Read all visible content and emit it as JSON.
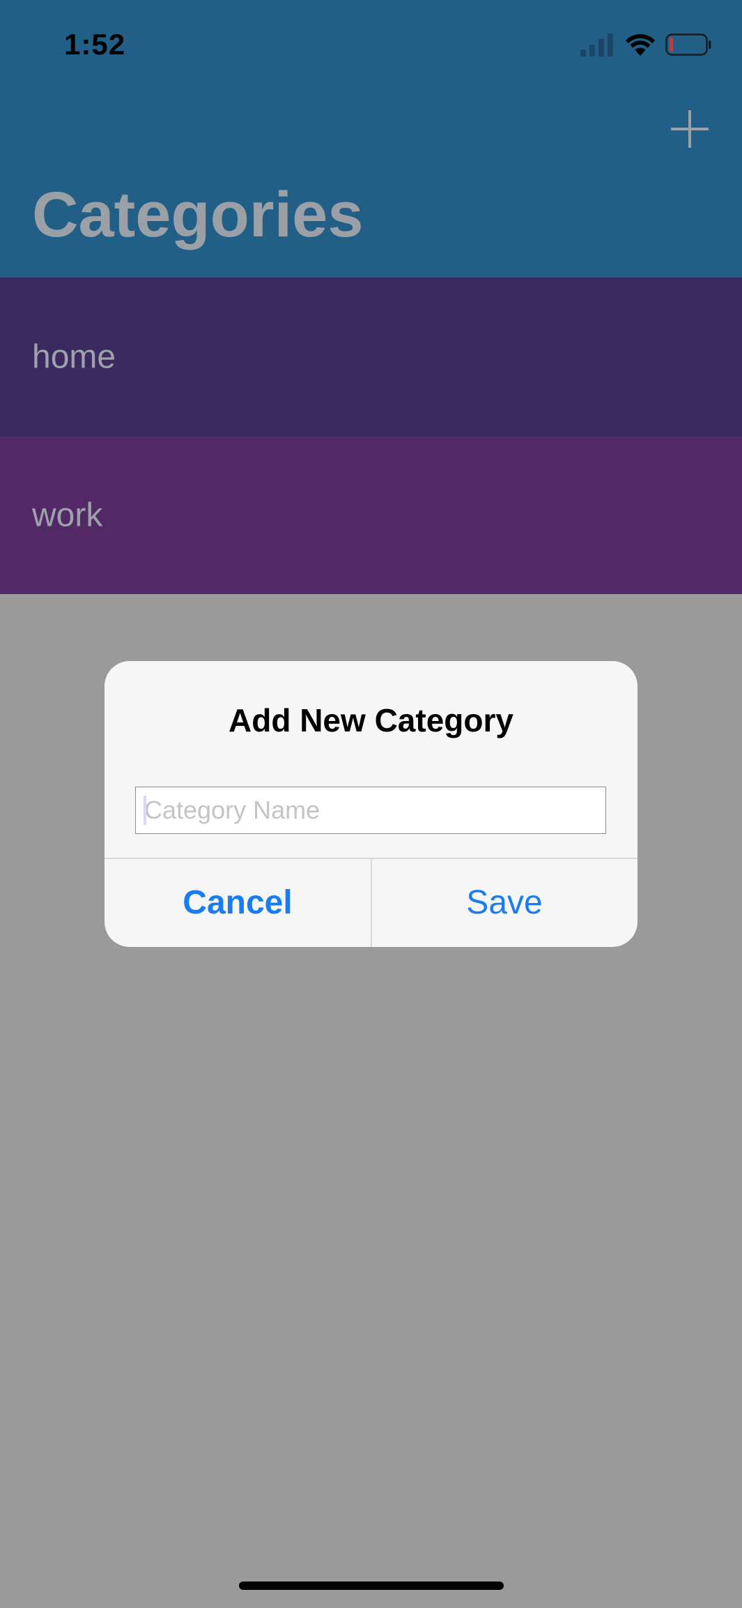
{
  "status_bar": {
    "time": "1:52"
  },
  "nav": {
    "title": "Categories",
    "add_icon": "plus-icon"
  },
  "categories": [
    {
      "name": "home",
      "color": "#3a2a5f"
    },
    {
      "name": "work",
      "color": "#532866"
    }
  ],
  "dialog": {
    "title": "Add New Category",
    "input_placeholder": "Category Name",
    "input_value": "",
    "cancel_label": "Cancel",
    "save_label": "Save"
  },
  "colors": {
    "header": "#215f86",
    "overlay": "#9a9a9a",
    "accent": "#1a7cf2"
  }
}
